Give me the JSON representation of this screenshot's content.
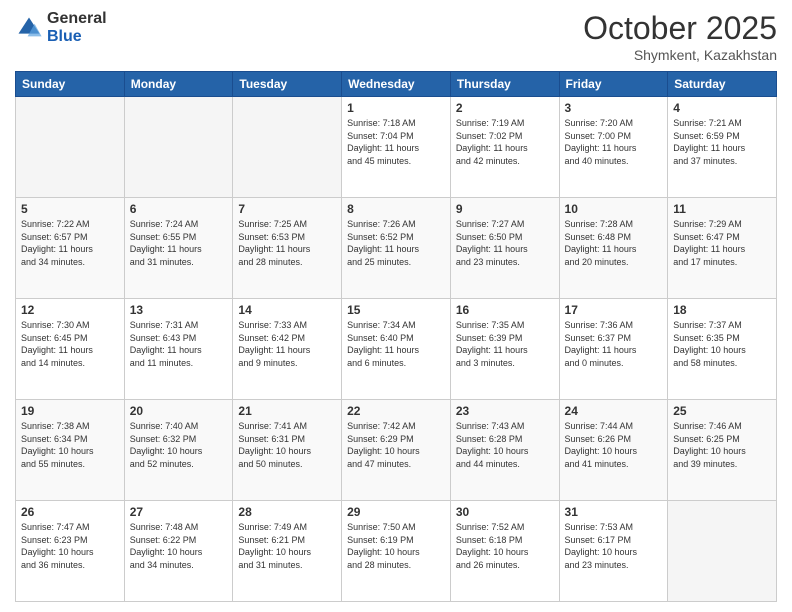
{
  "logo": {
    "general": "General",
    "blue": "Blue"
  },
  "header": {
    "month": "October 2025",
    "location": "Shymkent, Kazakhstan"
  },
  "weekdays": [
    "Sunday",
    "Monday",
    "Tuesday",
    "Wednesday",
    "Thursday",
    "Friday",
    "Saturday"
  ],
  "weeks": [
    [
      {
        "day": "",
        "info": ""
      },
      {
        "day": "",
        "info": ""
      },
      {
        "day": "",
        "info": ""
      },
      {
        "day": "1",
        "info": "Sunrise: 7:18 AM\nSunset: 7:04 PM\nDaylight: 11 hours\nand 45 minutes."
      },
      {
        "day": "2",
        "info": "Sunrise: 7:19 AM\nSunset: 7:02 PM\nDaylight: 11 hours\nand 42 minutes."
      },
      {
        "day": "3",
        "info": "Sunrise: 7:20 AM\nSunset: 7:00 PM\nDaylight: 11 hours\nand 40 minutes."
      },
      {
        "day": "4",
        "info": "Sunrise: 7:21 AM\nSunset: 6:59 PM\nDaylight: 11 hours\nand 37 minutes."
      }
    ],
    [
      {
        "day": "5",
        "info": "Sunrise: 7:22 AM\nSunset: 6:57 PM\nDaylight: 11 hours\nand 34 minutes."
      },
      {
        "day": "6",
        "info": "Sunrise: 7:24 AM\nSunset: 6:55 PM\nDaylight: 11 hours\nand 31 minutes."
      },
      {
        "day": "7",
        "info": "Sunrise: 7:25 AM\nSunset: 6:53 PM\nDaylight: 11 hours\nand 28 minutes."
      },
      {
        "day": "8",
        "info": "Sunrise: 7:26 AM\nSunset: 6:52 PM\nDaylight: 11 hours\nand 25 minutes."
      },
      {
        "day": "9",
        "info": "Sunrise: 7:27 AM\nSunset: 6:50 PM\nDaylight: 11 hours\nand 23 minutes."
      },
      {
        "day": "10",
        "info": "Sunrise: 7:28 AM\nSunset: 6:48 PM\nDaylight: 11 hours\nand 20 minutes."
      },
      {
        "day": "11",
        "info": "Sunrise: 7:29 AM\nSunset: 6:47 PM\nDaylight: 11 hours\nand 17 minutes."
      }
    ],
    [
      {
        "day": "12",
        "info": "Sunrise: 7:30 AM\nSunset: 6:45 PM\nDaylight: 11 hours\nand 14 minutes."
      },
      {
        "day": "13",
        "info": "Sunrise: 7:31 AM\nSunset: 6:43 PM\nDaylight: 11 hours\nand 11 minutes."
      },
      {
        "day": "14",
        "info": "Sunrise: 7:33 AM\nSunset: 6:42 PM\nDaylight: 11 hours\nand 9 minutes."
      },
      {
        "day": "15",
        "info": "Sunrise: 7:34 AM\nSunset: 6:40 PM\nDaylight: 11 hours\nand 6 minutes."
      },
      {
        "day": "16",
        "info": "Sunrise: 7:35 AM\nSunset: 6:39 PM\nDaylight: 11 hours\nand 3 minutes."
      },
      {
        "day": "17",
        "info": "Sunrise: 7:36 AM\nSunset: 6:37 PM\nDaylight: 11 hours\nand 0 minutes."
      },
      {
        "day": "18",
        "info": "Sunrise: 7:37 AM\nSunset: 6:35 PM\nDaylight: 10 hours\nand 58 minutes."
      }
    ],
    [
      {
        "day": "19",
        "info": "Sunrise: 7:38 AM\nSunset: 6:34 PM\nDaylight: 10 hours\nand 55 minutes."
      },
      {
        "day": "20",
        "info": "Sunrise: 7:40 AM\nSunset: 6:32 PM\nDaylight: 10 hours\nand 52 minutes."
      },
      {
        "day": "21",
        "info": "Sunrise: 7:41 AM\nSunset: 6:31 PM\nDaylight: 10 hours\nand 50 minutes."
      },
      {
        "day": "22",
        "info": "Sunrise: 7:42 AM\nSunset: 6:29 PM\nDaylight: 10 hours\nand 47 minutes."
      },
      {
        "day": "23",
        "info": "Sunrise: 7:43 AM\nSunset: 6:28 PM\nDaylight: 10 hours\nand 44 minutes."
      },
      {
        "day": "24",
        "info": "Sunrise: 7:44 AM\nSunset: 6:26 PM\nDaylight: 10 hours\nand 41 minutes."
      },
      {
        "day": "25",
        "info": "Sunrise: 7:46 AM\nSunset: 6:25 PM\nDaylight: 10 hours\nand 39 minutes."
      }
    ],
    [
      {
        "day": "26",
        "info": "Sunrise: 7:47 AM\nSunset: 6:23 PM\nDaylight: 10 hours\nand 36 minutes."
      },
      {
        "day": "27",
        "info": "Sunrise: 7:48 AM\nSunset: 6:22 PM\nDaylight: 10 hours\nand 34 minutes."
      },
      {
        "day": "28",
        "info": "Sunrise: 7:49 AM\nSunset: 6:21 PM\nDaylight: 10 hours\nand 31 minutes."
      },
      {
        "day": "29",
        "info": "Sunrise: 7:50 AM\nSunset: 6:19 PM\nDaylight: 10 hours\nand 28 minutes."
      },
      {
        "day": "30",
        "info": "Sunrise: 7:52 AM\nSunset: 6:18 PM\nDaylight: 10 hours\nand 26 minutes."
      },
      {
        "day": "31",
        "info": "Sunrise: 7:53 AM\nSunset: 6:17 PM\nDaylight: 10 hours\nand 23 minutes."
      },
      {
        "day": "",
        "info": ""
      }
    ]
  ]
}
